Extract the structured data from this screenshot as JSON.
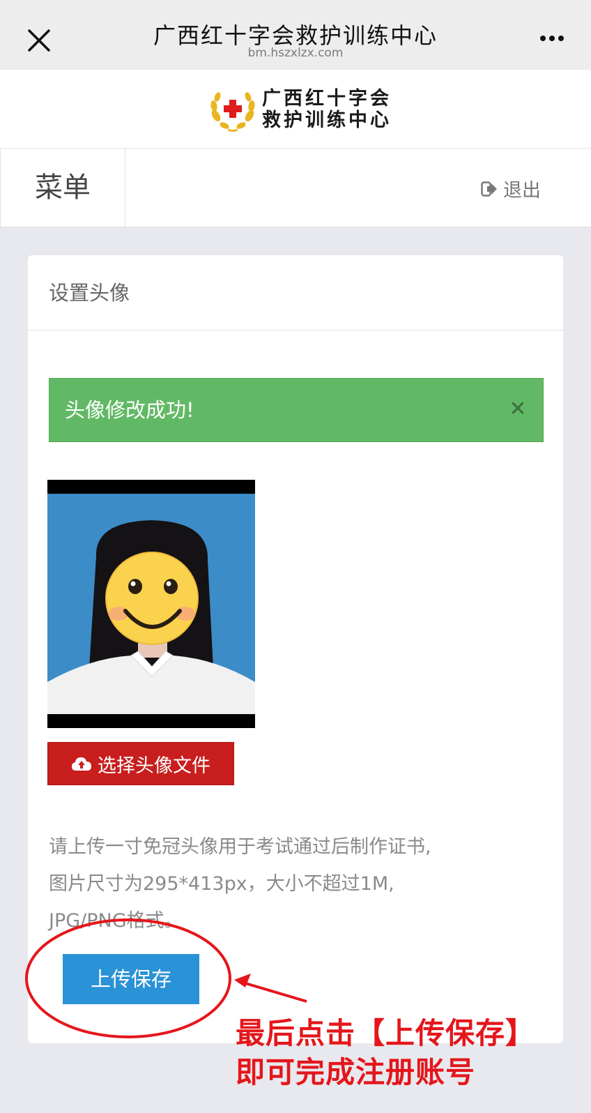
{
  "topbar": {
    "title": "广西红十字会救护训练中心",
    "url": "bm.hszxlzx.com"
  },
  "logo": {
    "line1": "广西红十字会",
    "line2": "救护训练中心"
  },
  "menubar": {
    "menu_label": "菜单",
    "logout_label": "退出"
  },
  "card": {
    "header": "设置头像",
    "alert_message": "头像修改成功!",
    "choose_file_label": "选择头像文件",
    "instructions": [
      "请上传一寸免冠头像用于考试通过后制作证书,",
      "图片尺寸为295*413px，大小不超过1M,",
      "JPG/PNG格式。"
    ],
    "save_label": "上传保存"
  },
  "annotation": {
    "line1": "最后点击【上传保存】",
    "line2": "即可完成注册账号"
  },
  "colors": {
    "alert_green": "#62b965",
    "choose_red": "#c81e1e",
    "save_blue": "#2a92d6",
    "annotation_red": "#e4161b"
  }
}
